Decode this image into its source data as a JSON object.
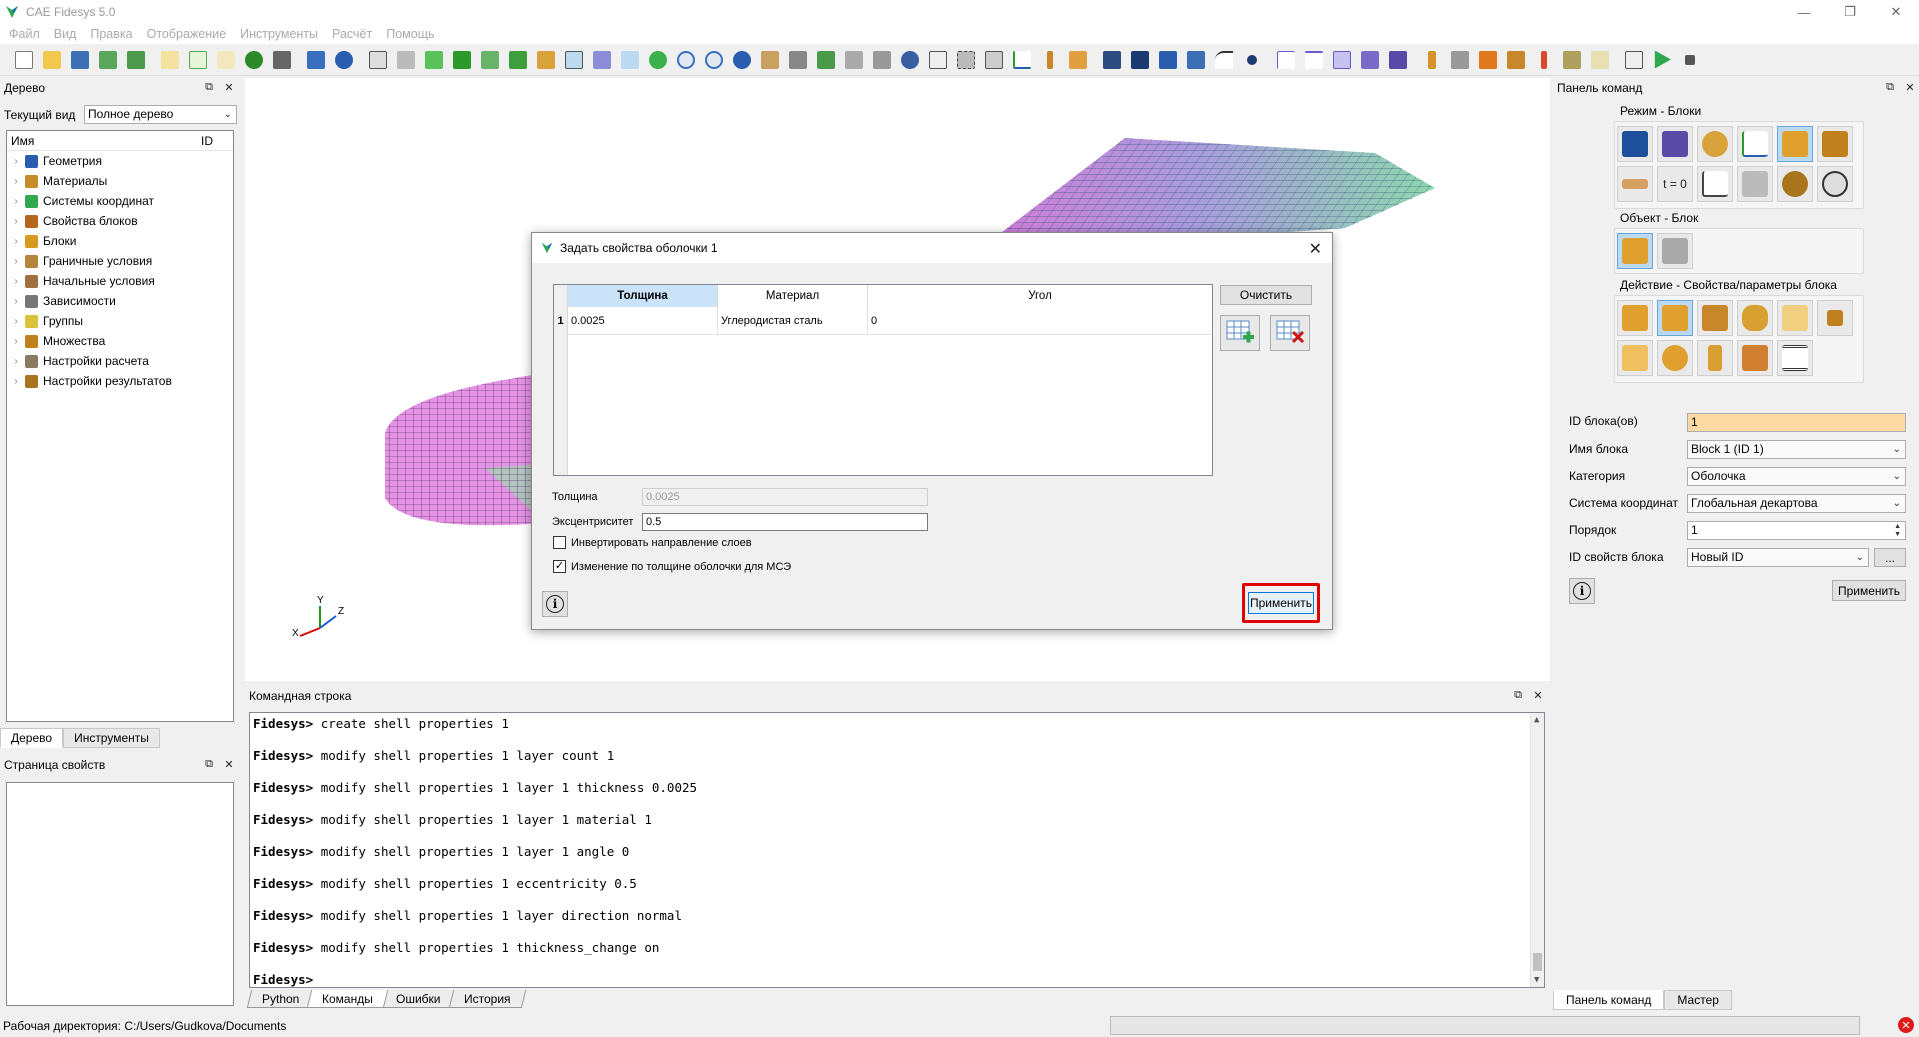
{
  "window": {
    "title": "CAE Fidesys 5.0"
  },
  "menu": [
    "Файл",
    "Вид",
    "Правка",
    "Отображение",
    "Инструменты",
    "Расчёт",
    "Помощь"
  ],
  "tree_panel": {
    "title": "Дерево",
    "current_view_label": "Текущий вид",
    "current_view_value": "Полное дерево",
    "col_name": "Имя",
    "col_id": "ID",
    "items": [
      {
        "label": "Геометрия",
        "icon": "geometry-icon",
        "color": "#2a5db0"
      },
      {
        "label": "Материалы",
        "icon": "materials-icon",
        "color": "#c78b2a"
      },
      {
        "label": "Системы координат",
        "icon": "coord-system-icon",
        "color": "#2fa84f"
      },
      {
        "label": "Свойства блоков",
        "icon": "block-props-icon",
        "color": "#b5651d"
      },
      {
        "label": "Блоки",
        "icon": "blocks-icon",
        "color": "#d89a1e"
      },
      {
        "label": "Граничные условия",
        "icon": "boundary-icon",
        "color": "#b5853b"
      },
      {
        "label": "Начальные условия",
        "icon": "initial-icon",
        "color": "#a07040"
      },
      {
        "label": "Зависимости",
        "icon": "dependencies-icon",
        "color": "#777777"
      },
      {
        "label": "Группы",
        "icon": "groups-icon",
        "color": "#d8c23a"
      },
      {
        "label": "Множества",
        "icon": "sets-icon",
        "color": "#c0801e"
      },
      {
        "label": "Настройки расчета",
        "icon": "calc-settings-icon",
        "color": "#8a7a60"
      },
      {
        "label": "Настройки результатов",
        "icon": "results-settings-icon",
        "color": "#a8741e"
      }
    ],
    "tabs": [
      "Дерево",
      "Инструменты"
    ]
  },
  "props_panel": {
    "title": "Страница свойств"
  },
  "command_line": {
    "title": "Командная строка",
    "lines": [
      {
        "prompt": "Fidesys>",
        "text": " create shell properties 1"
      },
      {
        "prompt": "Fidesys>",
        "text": " modify shell properties 1 layer count 1"
      },
      {
        "prompt": "Fidesys>",
        "text": " modify shell properties 1 layer 1 thickness 0.0025"
      },
      {
        "prompt": "Fidesys>",
        "text": " modify shell properties 1 layer 1 material 1"
      },
      {
        "prompt": "Fidesys>",
        "text": " modify shell properties 1 layer 1 angle 0"
      },
      {
        "prompt": "Fidesys>",
        "text": " modify shell properties 1 eccentricity 0.5"
      },
      {
        "prompt": "Fidesys>",
        "text": " modify shell properties 1 layer direction normal"
      },
      {
        "prompt": "Fidesys>",
        "text": " modify shell properties 1 thickness_change on"
      },
      {
        "prompt": "Fidesys>",
        "text": ""
      }
    ],
    "tabs": [
      "Python",
      "Команды",
      "Ошибки",
      "История"
    ],
    "active_tab": "Команды"
  },
  "status": {
    "workdir": "Рабочая директория: C:/Users/Gudkova/Documents"
  },
  "command_panel": {
    "title": "Панель команд",
    "mode_group": "Режим - Блоки",
    "object_group": "Объект - Блок",
    "action_group": "Действие - Свойства/параметры блока",
    "t0_label": "t = 0",
    "fields": {
      "block_ids_label": "ID блока(ов)",
      "block_ids_value": "1",
      "block_name_label": "Имя блока",
      "block_name_value": "Block 1 (ID 1)",
      "category_label": "Категория",
      "category_value": "Оболочка",
      "coord_label": "Система координат",
      "coord_value": "Глобальная декартова",
      "order_label": "Порядок",
      "order_value": "1",
      "prop_id_label": "ID свойств блока",
      "prop_id_value": "Новый ID"
    },
    "browse_label": "...",
    "apply_label": "Применить",
    "tabs": [
      "Панель команд",
      "Мастер"
    ]
  },
  "dialog": {
    "title": "Задать свойства оболочки 1",
    "columns": [
      "Толщина",
      "Материал",
      "Угол"
    ],
    "rows": [
      {
        "num": "1",
        "thickness": "0.0025",
        "material": "Углеродистая сталь",
        "angle": "0"
      }
    ],
    "clear_label": "Очистить",
    "thickness_label": "Толщина",
    "thickness_value": "0.0025",
    "eccentricity_label": "Эксцентриситет",
    "eccentricity_value": "0.5",
    "invert_label": "Инвертировать направление слоев",
    "invert_checked": false,
    "thickness_change_label": "Изменение по толщине оболочки для МСЭ",
    "thickness_change_checked": true,
    "apply_label": "Применить"
  },
  "colors": {
    "accent": "#2fa84f",
    "highlight_field": "#fdd9a4",
    "selection": "#cbe3f8",
    "apply_outline": "#e00000"
  }
}
